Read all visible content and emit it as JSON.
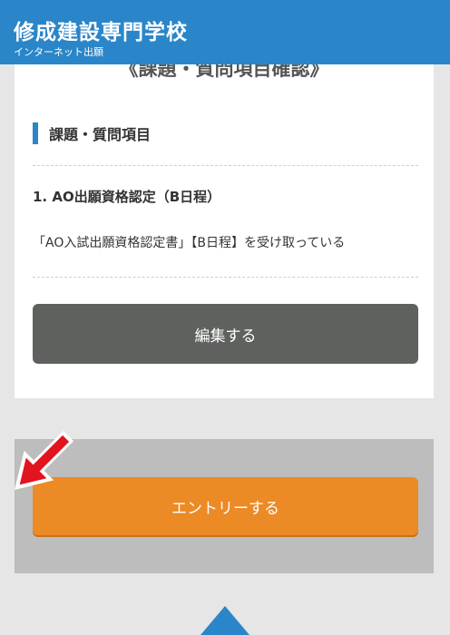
{
  "header": {
    "school_name": "修成建設専門学校",
    "subtitle": "インターネット出願"
  },
  "card": {
    "cut_off_title": "《課題・質問項目確認》",
    "section_heading": "課題・質問項目",
    "item_title": "1. AO出願資格認定（B日程）",
    "item_description": "「AO入試出願資格認定書」【B日程】を受け取っている",
    "edit_button_label": "編集する"
  },
  "entry": {
    "entry_button_label": "エントリーする"
  },
  "colors": {
    "header_blue": "#2a86c9",
    "edit_button_gray": "#5f615f",
    "entry_orange": "#ec8a25",
    "arrow_red": "#e2141f"
  }
}
